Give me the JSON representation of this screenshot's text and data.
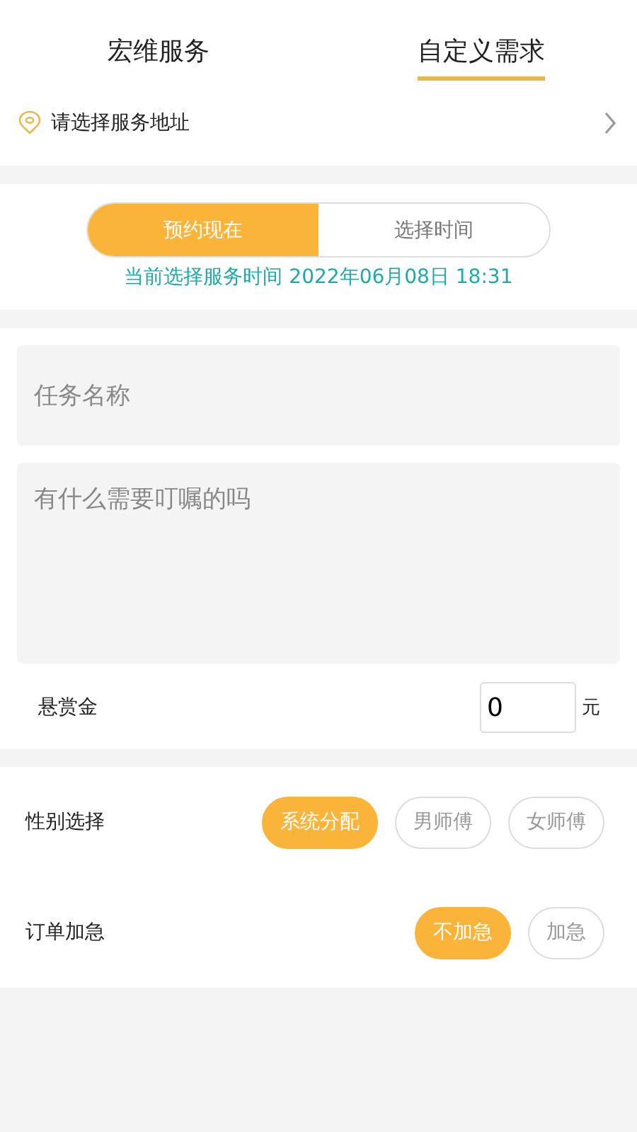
{
  "tabs": [
    {
      "label": "宏维服务",
      "selected": false
    },
    {
      "label": "自定义需求",
      "selected": true
    }
  ],
  "address": {
    "label": "请选择服务地址"
  },
  "time_mode": [
    {
      "label": "预约现在",
      "selected": true
    },
    {
      "label": "选择时间",
      "selected": false
    }
  ],
  "current_time": "当前选择服务时间 2022年06月08日 18:31",
  "task_name": {
    "placeholder": "任务名称"
  },
  "notes": {
    "placeholder": "有什么需要叮嘱的吗"
  },
  "reward": {
    "label": "悬赏金",
    "value": "0",
    "unit": "元"
  },
  "options": [
    {
      "label": "性别选择",
      "choices": [
        {
          "label": "系统分配",
          "selected": true
        },
        {
          "label": "男师傅",
          "selected": false
        },
        {
          "label": "女师傅",
          "selected": false
        }
      ]
    },
    {
      "label": "订单加急",
      "choices": [
        {
          "label": "不加急",
          "selected": true
        },
        {
          "label": "加急",
          "selected": false
        }
      ]
    }
  ]
}
